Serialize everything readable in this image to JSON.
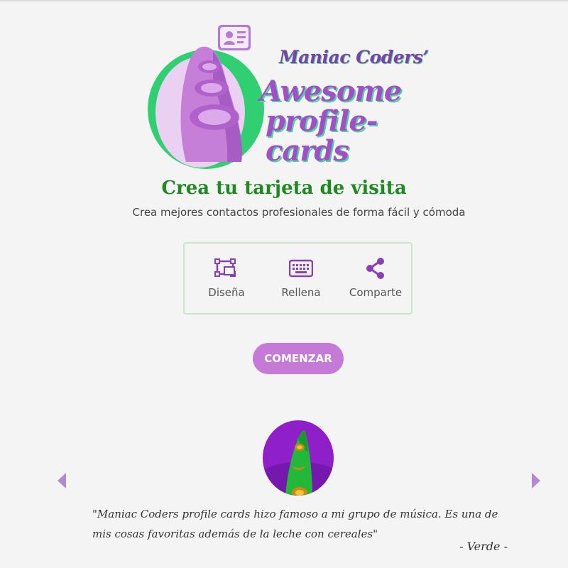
{
  "brand": {
    "line1": "Maniac Coders’",
    "line2": "Awesome",
    "line3": "profile-cards"
  },
  "hero": {
    "title": "Crea tu tarjeta de visita",
    "subtitle": "Crea mejores contactos profesionales de forma fácil y cómoda"
  },
  "steps": [
    {
      "icon": "object-select-icon",
      "label": "Diseña"
    },
    {
      "icon": "keyboard-icon",
      "label": "Rellena"
    },
    {
      "icon": "share-icon",
      "label": "Comparte"
    }
  ],
  "cta": {
    "label": "COMENZAR"
  },
  "testimonial": {
    "quote": "\"Maniac Coders profile cards hizo famoso a mi grupo de música. Es una de mis cosas favoritas además de la leche con cereales\"",
    "author": "- Verde -"
  },
  "colors": {
    "accent": "#c47ad6",
    "icon": "#8b3fb5",
    "headline": "#1f8a1f",
    "arrow": "#b38ad0"
  }
}
